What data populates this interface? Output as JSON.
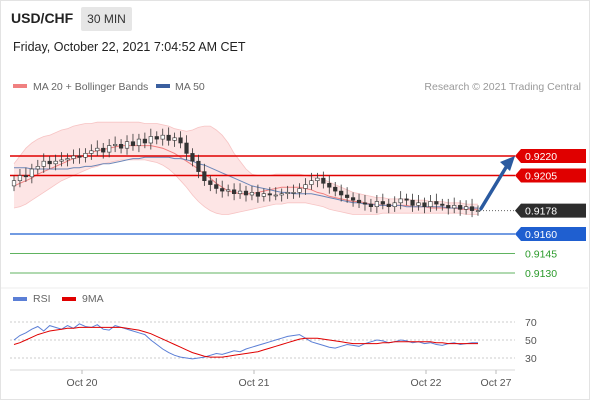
{
  "header": {
    "symbol": "USD/CHF",
    "timeframe": "30 MIN",
    "datetime": "Friday, October 22, 2021 7:04:52 AM CET"
  },
  "legend": {
    "bollinger": "MA 20 + Bollinger Bands",
    "ma50": "MA 50",
    "credit": "Research © 2021 Trading Central",
    "rsi": "RSI",
    "rsi_ma": "9MA"
  },
  "colors": {
    "bollinger": "#f08080",
    "bollinger_fill": "#fde2e2",
    "ma50": "#3a5f9f",
    "resistance": "#e00000",
    "pivot": "#1f5fd0",
    "support": "#2b9a2b",
    "rsi": "#5b7fd6",
    "rsi_ma": "#e00000",
    "last_price": "#2d2d2d",
    "arrow": "#2a5aa0"
  },
  "levels": [
    {
      "label": "0.9220",
      "price": 0.922,
      "kind": "resistance"
    },
    {
      "label": "0.9205",
      "price": 0.9205,
      "kind": "resistance"
    },
    {
      "label": "0.9178",
      "price": 0.9178,
      "kind": "last"
    },
    {
      "label": "0.9160",
      "price": 0.916,
      "kind": "pivot"
    },
    {
      "label": "0.9145",
      "price": 0.9145,
      "kind": "support"
    },
    {
      "label": "0.9130",
      "price": 0.913,
      "kind": "support"
    }
  ],
  "rsi_axis": [
    "70",
    "50",
    "30"
  ],
  "x_axis": [
    "Oct 20",
    "Oct 21",
    "Oct 22",
    "Oct 27"
  ],
  "chart_data": {
    "type": "candlestick",
    "y_range": [
      0.9125,
      0.926
    ],
    "price_close": [
      0.9201,
      0.9205,
      0.9204,
      0.921,
      0.9212,
      0.9216,
      0.9214,
      0.9216,
      0.9217,
      0.9218,
      0.922,
      0.9219,
      0.9222,
      0.9224,
      0.9226,
      0.9223,
      0.9228,
      0.9229,
      0.9226,
      0.9231,
      0.9228,
      0.9233,
      0.923,
      0.9235,
      0.9233,
      0.9236,
      0.9232,
      0.9234,
      0.923,
      0.9222,
      0.9216,
      0.9208,
      0.9201,
      0.9198,
      0.9195,
      0.9193,
      0.9194,
      0.9191,
      0.9193,
      0.919,
      0.9192,
      0.9189,
      0.9191,
      0.919,
      0.919,
      0.9191,
      0.9192,
      0.9192,
      0.9195,
      0.9198,
      0.9201,
      0.9203,
      0.9199,
      0.9196,
      0.9193,
      0.919,
      0.9188,
      0.9186,
      0.9184,
      0.9183,
      0.9181,
      0.9185,
      0.9183,
      0.9181,
      0.9184,
      0.9187,
      0.9186,
      0.9182,
      0.9184,
      0.9181,
      0.9185,
      0.9183,
      0.9182,
      0.918,
      0.9182,
      0.9179,
      0.9181,
      0.9178,
      0.9178
    ],
    "ma20": [
      0.9197,
      0.9199,
      0.9201,
      0.9203,
      0.9206,
      0.9208,
      0.921,
      0.9212,
      0.9214,
      0.9216,
      0.9218,
      0.9219,
      0.9221,
      0.9223,
      0.9224,
      0.9225,
      0.9226,
      0.9227,
      0.9228,
      0.9228,
      0.9228,
      0.9228,
      0.9228,
      0.9228,
      0.9227,
      0.9226,
      0.9224,
      0.9222,
      0.9219,
      0.9216,
      0.9213,
      0.921,
      0.9206,
      0.9203,
      0.9199,
      0.9196,
      0.9193,
      0.9192,
      0.9191,
      0.9191,
      0.9191,
      0.9192,
      0.9193,
      0.9194,
      0.9195,
      0.9196,
      0.9196,
      0.9196,
      0.9196,
      0.9195,
      0.9194,
      0.9192,
      0.9191,
      0.9189,
      0.9188,
      0.9187,
      0.9186,
      0.9185,
      0.9185,
      0.9184,
      0.9183,
      0.9183,
      0.9182,
      0.9182,
      0.9182,
      0.9182,
      0.9182,
      0.9181,
      0.9181,
      0.9181,
      0.918,
      0.918,
      0.918,
      0.918,
      0.918,
      0.9179,
      0.9179,
      0.9179,
      0.9179
    ],
    "ma50": [
      0.9211,
      0.9211,
      0.9211,
      0.921,
      0.921,
      0.921,
      0.921,
      0.921,
      0.921,
      0.921,
      0.9211,
      0.9211,
      0.9212,
      0.9212,
      0.9213,
      0.9214,
      0.9214,
      0.9215,
      0.9216,
      0.9217,
      0.9218,
      0.9218,
      0.9219,
      0.9219,
      0.9219,
      0.9219,
      0.9219,
      0.9218,
      0.9218,
      0.9217,
      0.9216,
      0.9214,
      0.9213,
      0.9211,
      0.9209,
      0.9207,
      0.9205,
      0.9203,
      0.9201,
      0.9199,
      0.9197,
      0.9196,
      0.9195,
      0.9194,
      0.9193,
      0.9192,
      0.9192,
      0.9191,
      0.9191,
      0.9191,
      0.9191,
      0.919,
      0.9189,
      0.9188,
      0.9187,
      0.9186,
      0.9185,
      0.9184,
      0.9184,
      0.9183,
      0.9183,
      0.9182,
      0.9182,
      0.9182,
      0.9182,
      0.9182,
      0.9181,
      0.9181,
      0.9181,
      0.9181,
      0.9181,
      0.9181,
      0.9181,
      0.918,
      0.918,
      0.918,
      0.918,
      0.918,
      0.918
    ],
    "bb_upper": [
      0.9214,
      0.922,
      0.9226,
      0.923,
      0.9233,
      0.9235,
      0.9236,
      0.9238,
      0.924,
      0.9241,
      0.9243,
      0.9244,
      0.9245,
      0.9245,
      0.9246,
      0.9246,
      0.9246,
      0.9246,
      0.9246,
      0.9246,
      0.9246,
      0.9246,
      0.9245,
      0.9245,
      0.9245,
      0.9244,
      0.9243,
      0.9241,
      0.924,
      0.9239,
      0.924,
      0.9242,
      0.9243,
      0.9243,
      0.924,
      0.9236,
      0.923,
      0.9222,
      0.9216,
      0.921,
      0.9206,
      0.9205,
      0.9205,
      0.9205,
      0.9206,
      0.9206,
      0.9206,
      0.9206,
      0.9206,
      0.9205,
      0.9204,
      0.9203,
      0.9202,
      0.92,
      0.9198,
      0.9196,
      0.9194,
      0.9192,
      0.9191,
      0.919,
      0.9189,
      0.9188,
      0.9188,
      0.9187,
      0.9187,
      0.9187,
      0.9187,
      0.9186,
      0.9186,
      0.9186,
      0.9185,
      0.9185,
      0.9185,
      0.9184,
      0.9184,
      0.9184,
      0.9183,
      0.9183,
      0.9183
    ],
    "bb_lower": [
      0.918,
      0.9181,
      0.9183,
      0.9186,
      0.9189,
      0.9192,
      0.9195,
      0.9198,
      0.9201,
      0.9203,
      0.9205,
      0.9207,
      0.9209,
      0.9211,
      0.9212,
      0.9214,
      0.9215,
      0.9216,
      0.9217,
      0.9217,
      0.9217,
      0.9217,
      0.9217,
      0.9216,
      0.9215,
      0.9213,
      0.921,
      0.9206,
      0.9201,
      0.9196,
      0.919,
      0.9185,
      0.9181,
      0.9178,
      0.9176,
      0.9175,
      0.9175,
      0.9176,
      0.9177,
      0.9178,
      0.9179,
      0.918,
      0.9181,
      0.9182,
      0.9183,
      0.9183,
      0.9184,
      0.9184,
      0.9184,
      0.9184,
      0.9183,
      0.9182,
      0.9181,
      0.9179,
      0.9178,
      0.9177,
      0.9176,
      0.9175,
      0.9175,
      0.9175,
      0.9175,
      0.9175,
      0.9176,
      0.9176,
      0.9176,
      0.9176,
      0.9176,
      0.9176,
      0.9176,
      0.9176,
      0.9176,
      0.9176,
      0.9176,
      0.9176,
      0.9176,
      0.9176,
      0.9175,
      0.9175,
      0.9175
    ],
    "rsi": [
      50,
      55,
      58,
      62,
      65,
      60,
      66,
      64,
      62,
      66,
      63,
      68,
      65,
      64,
      67,
      62,
      61,
      66,
      64,
      62,
      60,
      58,
      56,
      50,
      45,
      40,
      36,
      33,
      31,
      30,
      29,
      30,
      31,
      33,
      35,
      34,
      36,
      38,
      37,
      40,
      42,
      44,
      46,
      48,
      50,
      52,
      54,
      55,
      56,
      52,
      48,
      46,
      44,
      42,
      41,
      43,
      45,
      44,
      43,
      46,
      48,
      50,
      49,
      47,
      48,
      50,
      49,
      47,
      48,
      46,
      47,
      45,
      44,
      46,
      47,
      45,
      46,
      47,
      47
    ],
    "rsi_ma": [
      45,
      47,
      50,
      53,
      56,
      58,
      60,
      61,
      62,
      63,
      63,
      64,
      64,
      64,
      64,
      64,
      64,
      64,
      64,
      63,
      62,
      61,
      59,
      57,
      54,
      51,
      48,
      45,
      42,
      39,
      36,
      34,
      32,
      31,
      31,
      31,
      32,
      33,
      34,
      35,
      36,
      37,
      39,
      41,
      43,
      45,
      47,
      49,
      51,
      52,
      52,
      52,
      51,
      50,
      49,
      48,
      47,
      46,
      46,
      46,
      46,
      46,
      47,
      47,
      48,
      48,
      48,
      48,
      48,
      48,
      48,
      47,
      47,
      46,
      46,
      46,
      46,
      46,
      46
    ]
  }
}
